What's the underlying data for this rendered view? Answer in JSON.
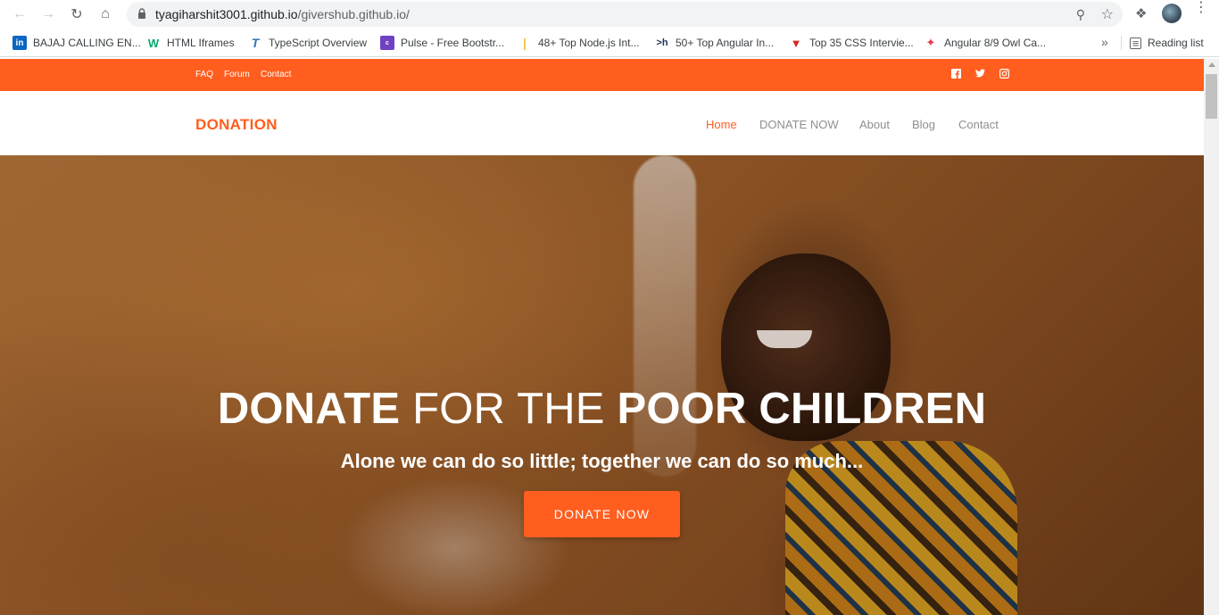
{
  "browser": {
    "url_host": "tyagiharshit3001.github.io",
    "url_path": "/givershub.github.io/",
    "bookmarks": [
      {
        "label": "BAJAJ CALLING EN...",
        "icon_text": "in",
        "color": "#0a66c2"
      },
      {
        "label": "HTML Iframes",
        "icon_text": "W",
        "color": "#04aa6d"
      },
      {
        "label": "TypeScript Overview",
        "icon_text": "T",
        "color": "#2f74c0"
      },
      {
        "label": "Pulse - Free Bootstr...",
        "icon_text": "c",
        "color": "#6f42c1"
      },
      {
        "label": "48+ Top Node.js Int...",
        "icon_text": "|",
        "color": "#f5c542"
      },
      {
        "label": "50+ Top Angular In...",
        "icon_text": ">h",
        "color": "#1d3557"
      },
      {
        "label": "Top 35 CSS Intervie...",
        "icon_text": "▼",
        "color": "#d62828"
      },
      {
        "label": "Angular 8/9 Owl Ca...",
        "icon_text": "✦",
        "color": "#e63946"
      }
    ],
    "more_label": "»",
    "reading_list": "Reading list"
  },
  "topbar": {
    "links": [
      "FAQ",
      "Forum",
      "Contact"
    ],
    "social_icons": [
      "facebook-icon",
      "twitter-icon",
      "instagram-icon"
    ],
    "color": "#ff5e1f"
  },
  "header": {
    "logo": "DONATION",
    "nav": [
      "Home",
      "DONATE NOW",
      "About",
      "Blog",
      "Contact"
    ],
    "active": "Home"
  },
  "hero": {
    "title_bold_1": "DONATE",
    "title_light": " FOR THE ",
    "title_bold_2": "POOR CHILDREN",
    "subtitle": "Alone we can do so little; together we can do so much...",
    "button_label": "DONATE NOW"
  }
}
